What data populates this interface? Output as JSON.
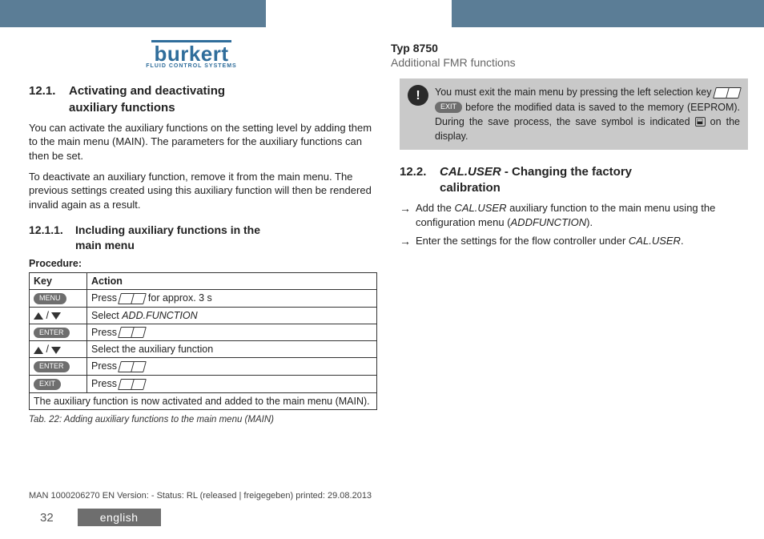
{
  "brand": {
    "name": "burkert",
    "tagline": "FLUID CONTROL SYSTEMS"
  },
  "meta": {
    "type": "Typ 8750",
    "section": "Additional FMR functions"
  },
  "left": {
    "sec_num": "12.1.",
    "sec_title_l1": "Activating and deactivating",
    "sec_title_l2": "auxiliary functions",
    "p1": "You can activate the auxiliary functions on the setting level by adding them to the main menu (MAIN). The parameters for the auxiliary functions can then be set.",
    "p2": "To deactivate an auxiliary function, remove it from the main menu. The previous settings created using this auxiliary function will then be rendered invalid again as a result.",
    "sub_num": "12.1.1.",
    "sub_title_l1": "Including auxiliary functions in the",
    "sub_title_l2": "main menu",
    "procedure_label": "Procedure:",
    "table": {
      "h1": "Key",
      "h2": "Action",
      "rows": [
        {
          "key_type": "badge",
          "key": "MENU",
          "action_prefix": "Press ",
          "action_suffix": " for approx. 3 s",
          "has_icon": true
        },
        {
          "key_type": "arrows",
          "action": "Select ",
          "ital": "ADD.FUNCTION"
        },
        {
          "key_type": "badge",
          "key": "ENTER",
          "action_prefix": "Press ",
          "has_icon": true
        },
        {
          "key_type": "arrows",
          "action": "Select the auxiliary function"
        },
        {
          "key_type": "badge",
          "key": "ENTER",
          "action_prefix": "Press ",
          "has_icon": true
        },
        {
          "key_type": "badge",
          "key": "EXIT",
          "action_prefix": "Press ",
          "has_icon": true
        }
      ],
      "footer": "The auxiliary function is now activated and added to the main menu (MAIN)."
    },
    "caption": "Tab. 22:   Adding auxiliary functions to the main menu (MAIN)"
  },
  "right": {
    "info_pre": "You must exit the main menu by pressing the left selection key ",
    "info_badge": "EXIT",
    "info_mid": " before the modified data is saved to the memory (EEPROM). During the save process, the save symbol is indicated ",
    "info_post": " on the display.",
    "sec_num": "12.2.",
    "sec_ital": "CAL.USER",
    "sec_rest_l1": " - Changing the factory",
    "sec_rest_l2": "calibration",
    "b1_pre": "Add the ",
    "b1_i1": "CAL.USER",
    "b1_mid": " auxiliary function to the main menu using the configuration menu (",
    "b1_i2": "ADDFUNCTION",
    "b1_post": ").",
    "b2_pre": "Enter the settings for the flow controller under ",
    "b2_i1": "CAL.USER",
    "b2_post": "."
  },
  "footer": {
    "doc_line": "MAN  1000206270  EN  Version: - Status: RL  (released | freigegeben)   printed: 29.08.2013",
    "page": "32",
    "lang": "english"
  }
}
